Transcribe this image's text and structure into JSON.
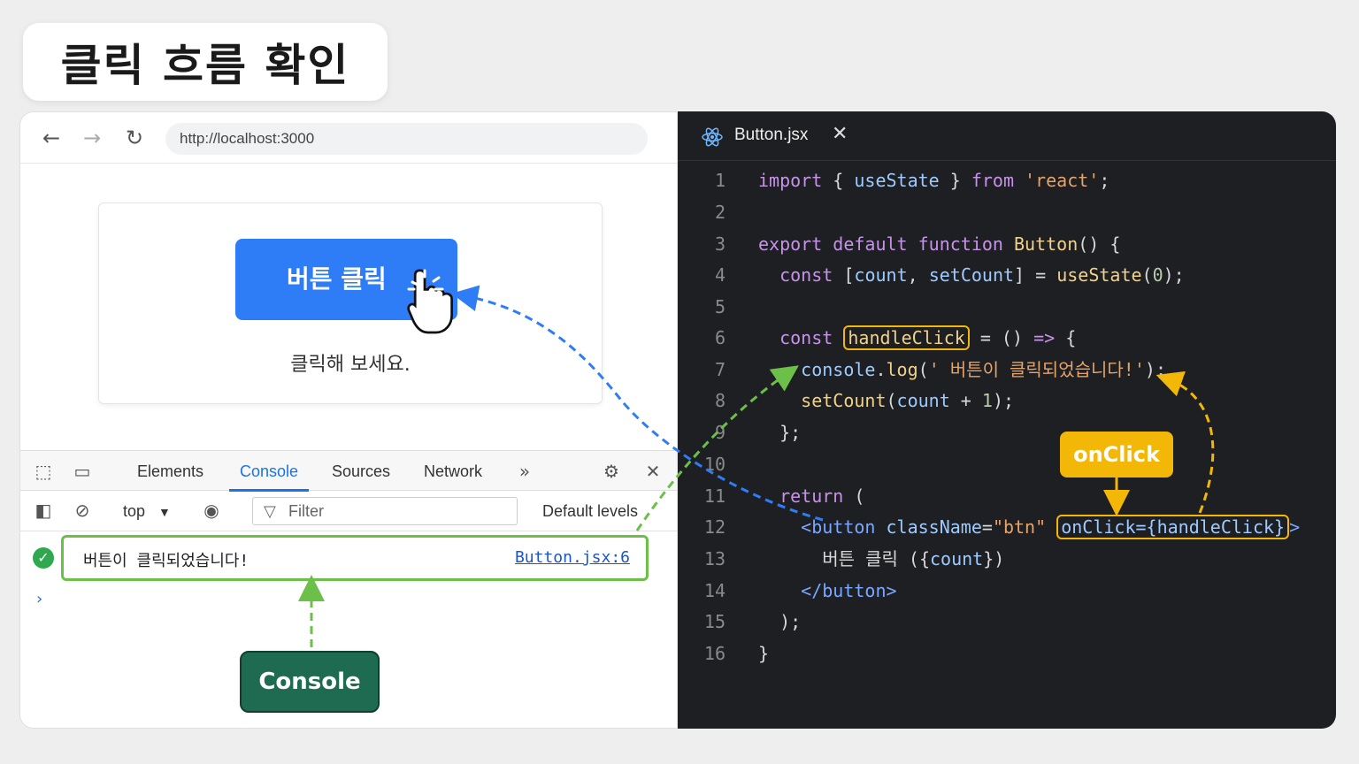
{
  "slide_title": "클릭 흐름 확인",
  "browser": {
    "url": "http://localhost:3000",
    "app": {
      "button_label": "버튼 클릭",
      "hint_text": "클릭해 보세요."
    }
  },
  "devtools": {
    "tabs": [
      "Elements",
      "Console",
      "Sources",
      "Network"
    ],
    "active_tab": "Console",
    "context": "top",
    "filter_placeholder": "Filter",
    "levels": "Default levels",
    "log": {
      "message": "버튼이 클릭되었습니다!",
      "source": "Button.jsx:6"
    }
  },
  "badges": {
    "console": "Console",
    "onclick": "onClick"
  },
  "editor": {
    "filename": "Button.jsx",
    "line_numbers": [
      "1",
      "2",
      "3",
      "4",
      "5",
      "6",
      "7",
      "8",
      "9",
      "10",
      "11",
      "12",
      "13",
      "14",
      "15",
      "16"
    ]
  },
  "colors": {
    "accent_blue": "#2f7df6",
    "console_green": "#1f6b52",
    "onclick_yellow": "#f2b707",
    "log_border": "#6cc04a"
  }
}
